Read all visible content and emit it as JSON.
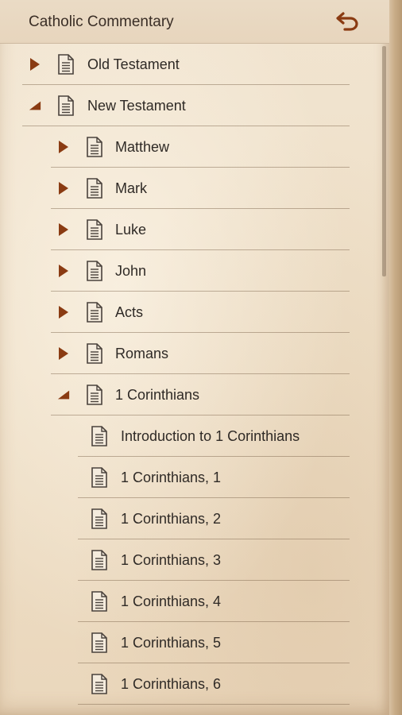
{
  "header": {
    "title": "Catholic Commentary",
    "back_icon": "undo-arrow-icon",
    "accent_color": "#8a3b12"
  },
  "tree": {
    "rows": [
      {
        "label": "Old Testament",
        "level": 0,
        "state": "collapsed"
      },
      {
        "label": "New Testament",
        "level": 0,
        "state": "expanded"
      },
      {
        "label": "Matthew",
        "level": 1,
        "state": "collapsed"
      },
      {
        "label": "Mark",
        "level": 1,
        "state": "collapsed"
      },
      {
        "label": "Luke",
        "level": 1,
        "state": "collapsed"
      },
      {
        "label": "John",
        "level": 1,
        "state": "collapsed"
      },
      {
        "label": "Acts",
        "level": 1,
        "state": "collapsed"
      },
      {
        "label": "Romans",
        "level": 1,
        "state": "collapsed"
      },
      {
        "label": "1 Corinthians",
        "level": 1,
        "state": "expanded"
      },
      {
        "label": "Introduction to 1 Corinthians",
        "level": 2,
        "state": "leaf"
      },
      {
        "label": "1 Corinthians, 1",
        "level": 2,
        "state": "leaf"
      },
      {
        "label": "1 Corinthians, 2",
        "level": 2,
        "state": "leaf"
      },
      {
        "label": "1 Corinthians, 3",
        "level": 2,
        "state": "leaf"
      },
      {
        "label": "1 Corinthians, 4",
        "level": 2,
        "state": "leaf"
      },
      {
        "label": "1 Corinthians, 5",
        "level": 2,
        "state": "leaf"
      },
      {
        "label": "1 Corinthians, 6",
        "level": 2,
        "state": "leaf"
      }
    ]
  }
}
